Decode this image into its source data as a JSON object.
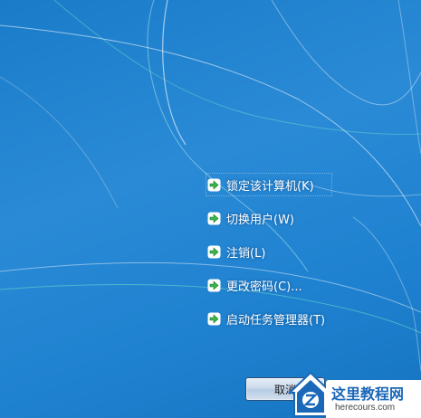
{
  "menu": {
    "items": [
      {
        "label": "锁定该计算机(K)"
      },
      {
        "label": "切换用户(W)"
      },
      {
        "label": "注销(L)"
      },
      {
        "label": "更改密码(C)..."
      },
      {
        "label": "启动任务管理器(T)"
      }
    ]
  },
  "cancel_button": {
    "label": "取消"
  },
  "watermark": {
    "title": "这里教程网",
    "url": "herecours.com"
  },
  "colors": {
    "background": "#1f82d0",
    "text": "#ffffff",
    "arrow": "#3ab54a"
  }
}
